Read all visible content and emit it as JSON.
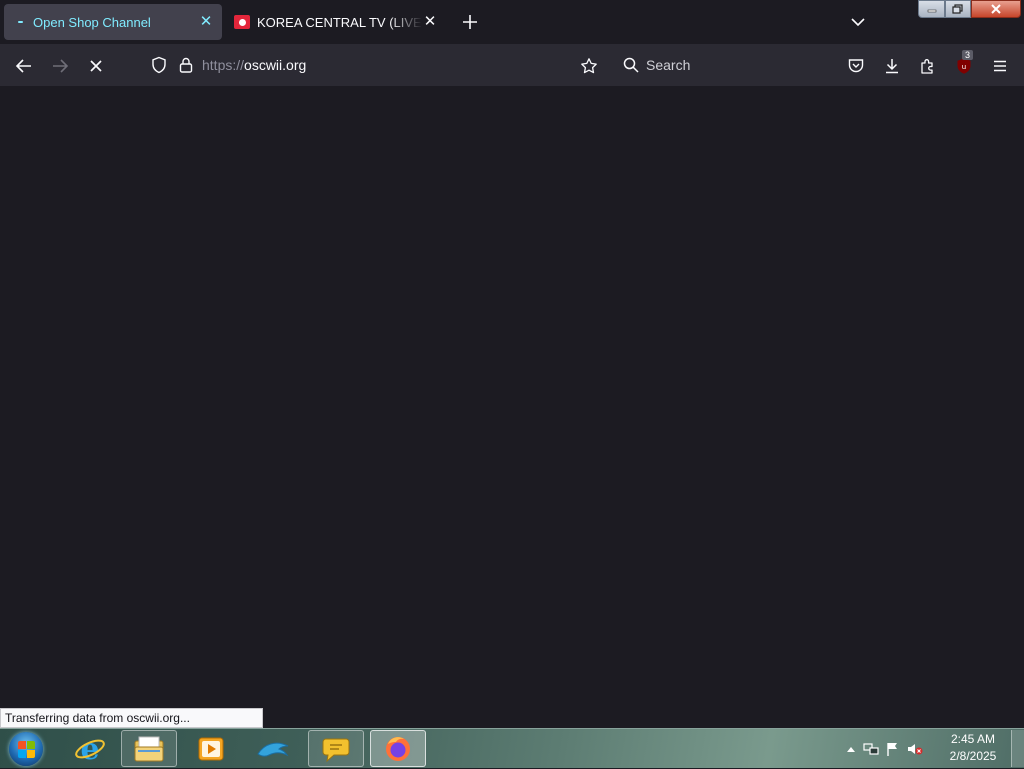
{
  "tabs": [
    {
      "title": "Open Shop Channel",
      "close": "✕",
      "active": true
    },
    {
      "title": "KOREA CENTRAL TV (LIVESTREAM)",
      "close": "✕",
      "active": false
    }
  ],
  "tabstrip": {
    "new_tab_icon": "plus-icon",
    "list_all_tabs_icon": "chevron-down-icon"
  },
  "window_controls": {
    "minimize_icon": "minimize-icon",
    "restore_icon": "restore-icon",
    "close_icon": "close-icon"
  },
  "navbar": {
    "back_icon": "back-arrow-icon",
    "forward_icon": "forward-arrow-icon",
    "stop_icon": "stop-loading-icon",
    "url_scheme": "https://",
    "url_host": "oscwii.org",
    "search_placeholder": "Search",
    "extensions_badge": "3"
  },
  "status": {
    "text": "Transferring data from oscwii.org..."
  },
  "taskbar": {
    "items": [
      "internet-explorer-icon",
      "file-explorer-icon",
      "media-player-icon",
      "dolphin-emulator-icon",
      "chat-bubble-icon",
      "firefox-icon"
    ],
    "clock_time": "2:45 AM",
    "clock_date": "2/8/2025"
  },
  "colors": {
    "tab_active_text": "#80ebff",
    "toolbar_bg": "#2b2a33",
    "content_bg": "#1c1b22",
    "ublock_red": "#800000"
  }
}
